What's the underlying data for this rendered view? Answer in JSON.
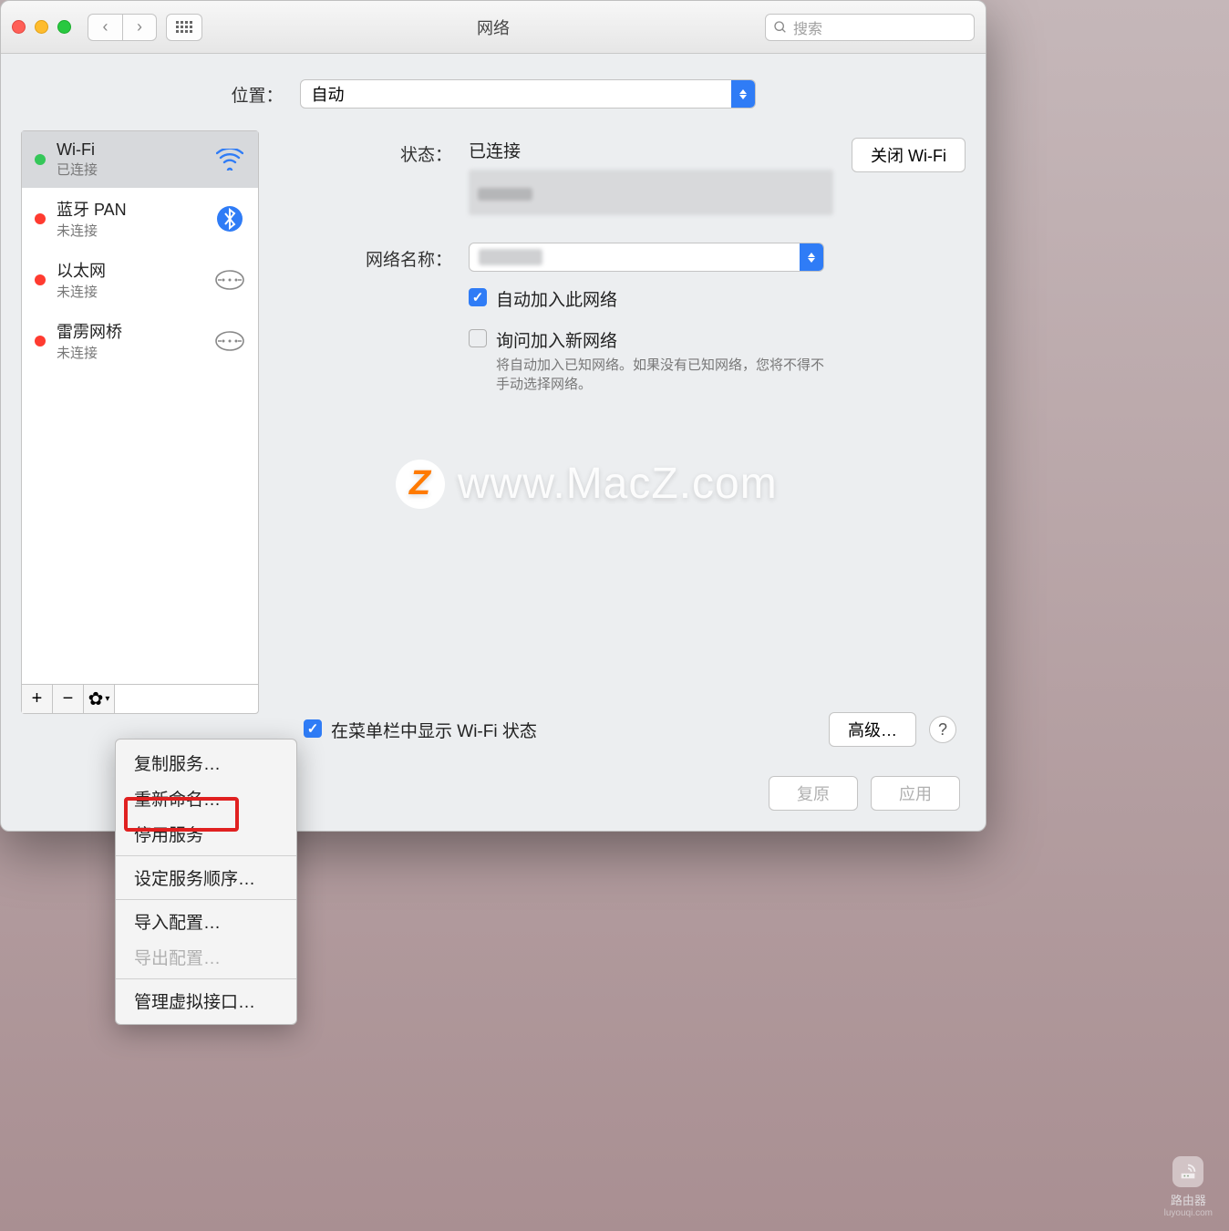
{
  "window": {
    "title": "网络"
  },
  "search": {
    "placeholder": "搜索"
  },
  "location": {
    "label": "位置：",
    "value": "自动"
  },
  "sidebar": {
    "items": [
      {
        "name": "Wi-Fi",
        "status": "已连接",
        "dot": "g",
        "icon": "wifi"
      },
      {
        "name": "蓝牙 PAN",
        "status": "未连接",
        "dot": "r",
        "icon": "bt"
      },
      {
        "name": "以太网",
        "status": "未连接",
        "dot": "r",
        "icon": "eth"
      },
      {
        "name": "雷雳网桥",
        "status": "未连接",
        "dot": "r",
        "icon": "eth"
      }
    ]
  },
  "detail": {
    "status_label": "状态：",
    "status_value": "已连接",
    "wifi_off_btn": "关闭 Wi-Fi",
    "netname_label": "网络名称：",
    "auto_join": "自动加入此网络",
    "ask_join": "询问加入新网络",
    "ask_help": "将自动加入已知网络。如果没有已知网络，您将不得不手动选择网络。",
    "show_menubar": "在菜单栏中显示 Wi-Fi 状态",
    "advanced_btn": "高级…"
  },
  "footer": {
    "revert": "复原",
    "apply": "应用"
  },
  "ctx": {
    "dup": "复制服务…",
    "rename": "重新命名…",
    "disable": "停用服务",
    "order": "设定服务顺序…",
    "import": "导入配置…",
    "export": "导出配置…",
    "manage": "管理虚拟接口…"
  },
  "watermark": {
    "letter": "Z",
    "text": "www.MacZ.com"
  },
  "corner_label": "路由器"
}
